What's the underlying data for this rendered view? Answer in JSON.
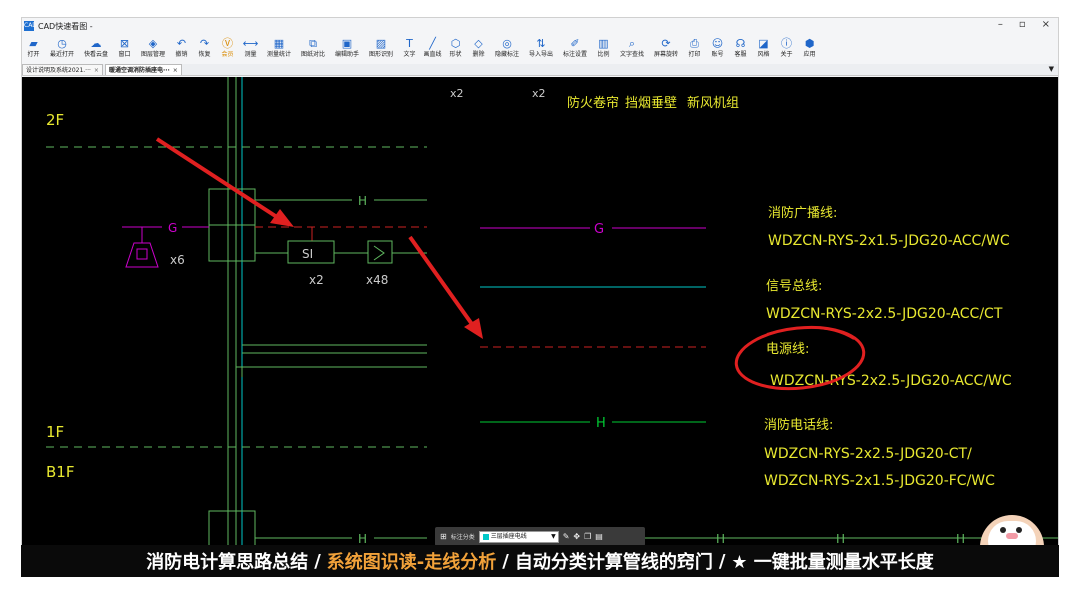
{
  "window": {
    "title": "CAD快速看图 -",
    "app_icon": "CAD"
  },
  "window_controls": {
    "minimize": "–",
    "restore": "▫",
    "close": "×"
  },
  "toolbar": [
    {
      "label": "打开",
      "icon": "folder-icon"
    },
    {
      "label": "最近打开",
      "icon": "history-icon"
    },
    {
      "label": "快看云盘",
      "icon": "cloud-icon"
    },
    {
      "label": "窗口",
      "icon": "window-icon"
    },
    {
      "label": "图层管理",
      "icon": "layers-icon"
    },
    {
      "label": "撤销",
      "icon": "undo-icon"
    },
    {
      "label": "恢复",
      "icon": "redo-icon"
    },
    {
      "label": "会员",
      "icon": "vip-icon"
    },
    {
      "label": "测量",
      "icon": "measure-icon"
    },
    {
      "label": "测量统计",
      "icon": "measure-stats-icon"
    },
    {
      "label": "图纸对比",
      "icon": "compare-icon"
    },
    {
      "label": "编辑助手",
      "icon": "edit-helper-icon"
    },
    {
      "label": "图形识别",
      "icon": "shape-recognize-icon"
    },
    {
      "label": "文字",
      "icon": "text-icon"
    },
    {
      "label": "画直线",
      "icon": "line-icon"
    },
    {
      "label": "形状",
      "icon": "shape-icon"
    },
    {
      "label": "删除",
      "icon": "eraser-icon"
    },
    {
      "label": "隐藏标注",
      "icon": "hide-annotation-icon"
    },
    {
      "label": "导入导出",
      "icon": "import-export-icon"
    },
    {
      "label": "标注设置",
      "icon": "annotation-settings-icon"
    },
    {
      "label": "比例",
      "icon": "scale-icon"
    },
    {
      "label": "文字查找",
      "icon": "text-search-icon"
    },
    {
      "label": "屏幕旋转",
      "icon": "rotate-icon"
    },
    {
      "label": "打印",
      "icon": "print-icon"
    },
    {
      "label": "账号",
      "icon": "account-icon"
    },
    {
      "label": "客服",
      "icon": "headset-icon"
    },
    {
      "label": "风格",
      "icon": "style-icon"
    },
    {
      "label": "关于",
      "icon": "info-icon"
    },
    {
      "label": "应用",
      "icon": "apps-icon"
    }
  ],
  "tabs": [
    {
      "label": "设计说明及系统2021.···",
      "active": false
    },
    {
      "label": "暖通空调消防插座电···",
      "active": true
    }
  ],
  "drawing": {
    "floor_labels": [
      "2F",
      "1F",
      "B1F"
    ],
    "top_labels": [
      "x2",
      "x2",
      "防火卷帘",
      "挡烟垂壁",
      "新风机组"
    ],
    "line_letter_g": "G",
    "line_letter_h": "H",
    "device_si": "SI",
    "speaker_count": "x6",
    "si_count": "x2",
    "module_count": "x48",
    "legend": [
      {
        "title": "消防广播线:",
        "spec": "WDZCN-RYS-2x1.5-JDG20-ACC/WC",
        "color": "#cc00cc",
        "letter": "G"
      },
      {
        "title": "信号总线:",
        "spec": "WDZCN-RYS-2x2.5-JDG20-ACC/CT",
        "color": "#00c8c8",
        "letter": ""
      },
      {
        "title": "电源线:",
        "spec": "WDZCN-RYS-2x2.5-JDG20-ACC/WC",
        "color": "#cc2222",
        "letter": ""
      },
      {
        "title": "消防电话线:",
        "spec_line1": "WDZCN-RYS-2x2.5-JDG20-CT/",
        "spec_line2": "WDZCN-RYS-2x1.5-JDG20-FC/WC",
        "color": "#00cc33",
        "letter": "H"
      }
    ]
  },
  "cursor_bar": {
    "label": "标注分类",
    "selected": "三层插座电线"
  },
  "subtitle": {
    "part1": "消防电计算思路总结",
    "sep": "/",
    "part2": "系统图识读-走线分析",
    "part3": "自动分类计算管线的窍门",
    "part4": "★ 一键批量测量水平长度"
  },
  "colors": {
    "cad_yellow": "#e8e830",
    "grid_green": "#5fb85f",
    "annotation_red": "#e02020"
  }
}
